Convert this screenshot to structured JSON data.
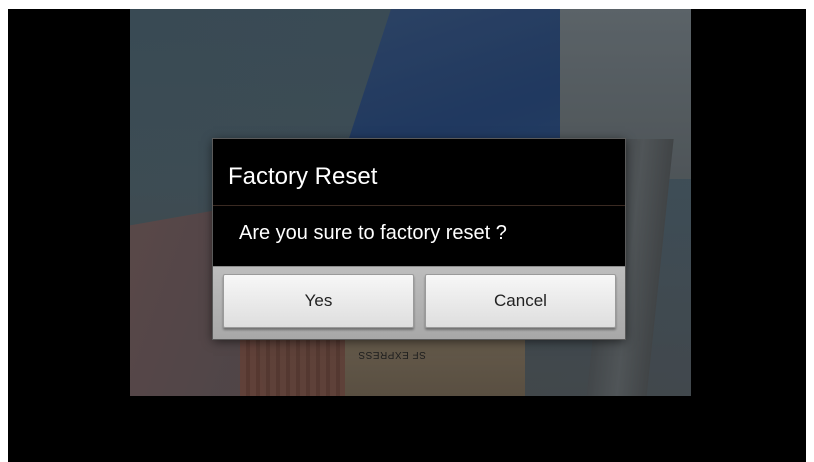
{
  "dialog": {
    "title": "Factory Reset",
    "message": "Are you sure to factory reset ?",
    "buttons": {
      "yes": "Yes",
      "cancel": "Cancel"
    }
  },
  "background": {
    "box_label": "SF EXPRESS"
  }
}
